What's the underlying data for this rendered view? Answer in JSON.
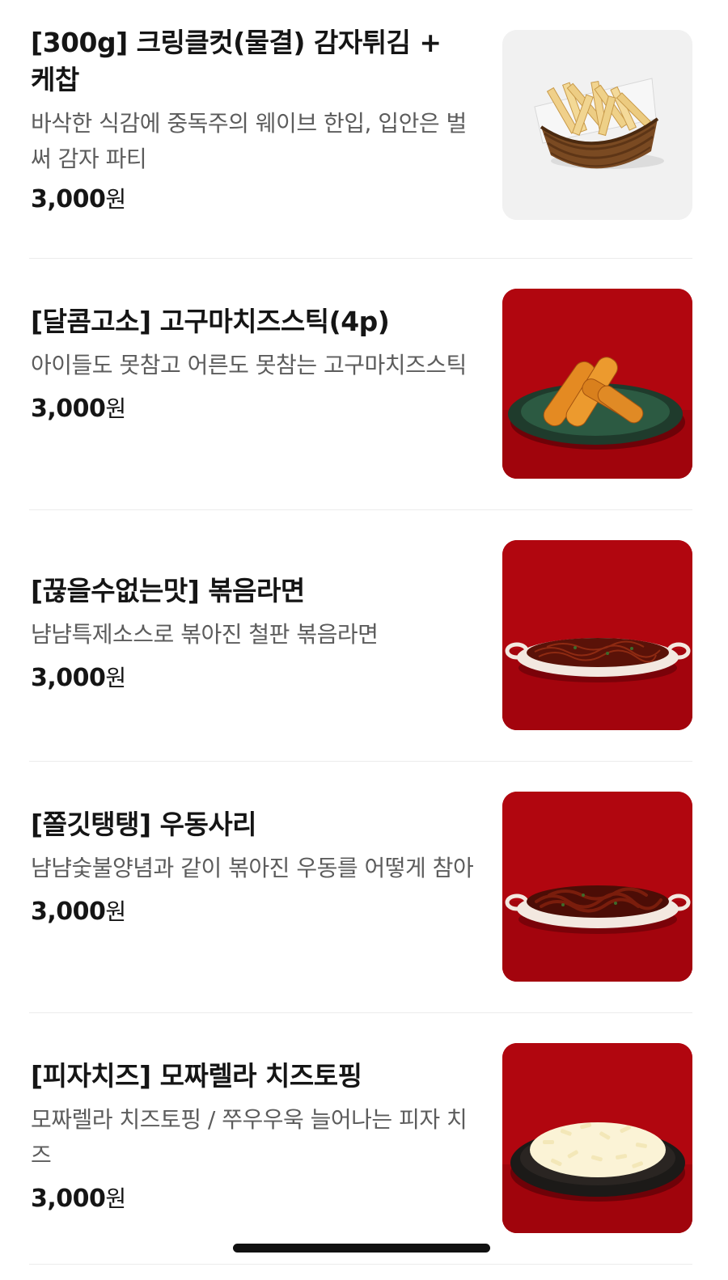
{
  "menu": {
    "items": [
      {
        "name": "[300g] 크링클컷(물결) 감자튀김 + 케찹",
        "description": "바삭한 식감에 중독주의 웨이브 한입, 입안은 벌써 감자 파티",
        "price": "3,000",
        "currency": "원",
        "image_icon": "crinkle-fries-basket-icon",
        "image_bg": "#f1f1f1"
      },
      {
        "name": "[달콤고소] 고구마치즈스틱(4p)",
        "description": "아이들도 못참고 어른도 못참는 고구마치즈스틱",
        "price": "3,000",
        "currency": "원",
        "image_icon": "cheese-sticks-plate-icon",
        "image_bg": "#b1060f"
      },
      {
        "name": "[끊을수없는맛] 볶음라면",
        "description": "냠냠특제소스로 볶아진 철판 볶음라면",
        "price": "3,000",
        "currency": "원",
        "image_icon": "fried-ramen-dish-icon",
        "image_bg": "#b1060f"
      },
      {
        "name": "[쫄깃탱탱] 우동사리",
        "description": "냠냠숯불양념과 같이 볶아진 우동를 어떻게 참아",
        "price": "3,000",
        "currency": "원",
        "image_icon": "udon-dish-icon",
        "image_bg": "#b1060f"
      },
      {
        "name": "[피자치즈] 모짜렐라 치즈토핑",
        "description": "모짜렐라 치즈토핑 / 쭈우우욱 늘어나는 피자 치즈",
        "price": "3,000",
        "currency": "원",
        "image_icon": "mozzarella-cheese-bowl-icon",
        "image_bg": "#b1060f"
      }
    ]
  },
  "colors": {
    "red_background": "#b1060f",
    "light_background": "#f1f1f1",
    "title_text": "#151515",
    "description_text": "#5c5c5c",
    "divider": "#ececec"
  }
}
